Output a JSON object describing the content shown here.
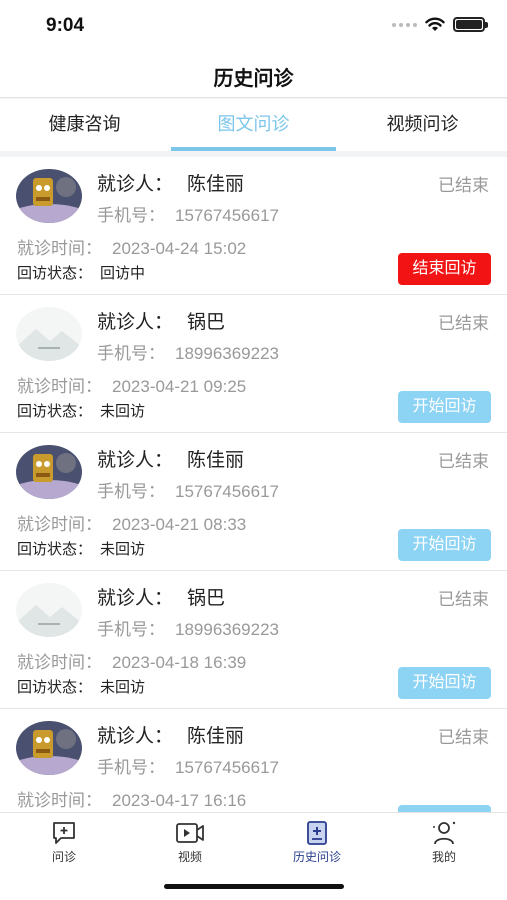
{
  "status_bar": {
    "time": "9:04"
  },
  "nav": {
    "title": "历史问诊"
  },
  "tabs": [
    {
      "label": "健康咨询",
      "active": false
    },
    {
      "label": "图文问诊",
      "active": true
    },
    {
      "label": "视频问诊",
      "active": false
    }
  ],
  "labels": {
    "patient": "就诊人：",
    "phone": "手机号：",
    "visit_time": "就诊时间：",
    "followup": "回访状态："
  },
  "records": [
    {
      "avatar": "cartoon-avatar",
      "patient": "陈佳丽",
      "phone": "15767456617",
      "status": "已结束",
      "visit_time": "2023-04-24 15:02",
      "followup": "回访中",
      "action": "结束回访",
      "action_color": "#f21414"
    },
    {
      "avatar": "placeholder-avatar",
      "patient": "锅巴",
      "phone": "18996369223",
      "status": "已结束",
      "visit_time": "2023-04-21 09:25",
      "followup": "未回访",
      "action": "开始回访",
      "action_color": "#8dd3f4"
    },
    {
      "avatar": "cartoon-avatar",
      "patient": "陈佳丽",
      "phone": "15767456617",
      "status": "已结束",
      "visit_time": "2023-04-21 08:33",
      "followup": "未回访",
      "action": "开始回访",
      "action_color": "#8dd3f4"
    },
    {
      "avatar": "placeholder-avatar",
      "patient": "锅巴",
      "phone": "18996369223",
      "status": "已结束",
      "visit_time": "2023-04-18 16:39",
      "followup": "未回访",
      "action": "开始回访",
      "action_color": "#8dd3f4"
    },
    {
      "avatar": "cartoon-avatar",
      "patient": "陈佳丽",
      "phone": "15767456617",
      "status": "已结束",
      "visit_time": "2023-04-17 16:16",
      "followup": "",
      "action": "",
      "action_color": "#8dd3f4"
    }
  ],
  "tabbar": [
    {
      "label": "问诊",
      "icon": "chat-plus-icon",
      "active": false
    },
    {
      "label": "视频",
      "icon": "video-icon",
      "active": false
    },
    {
      "label": "历史问诊",
      "icon": "history-record-icon",
      "active": true
    },
    {
      "label": "我的",
      "icon": "profile-icon",
      "active": false
    }
  ],
  "colors": {
    "accent": "#7cc6ea",
    "end_button": "#f21414",
    "start_button": "#8dd3f4",
    "tabbar_active": "#2a3d8f"
  }
}
